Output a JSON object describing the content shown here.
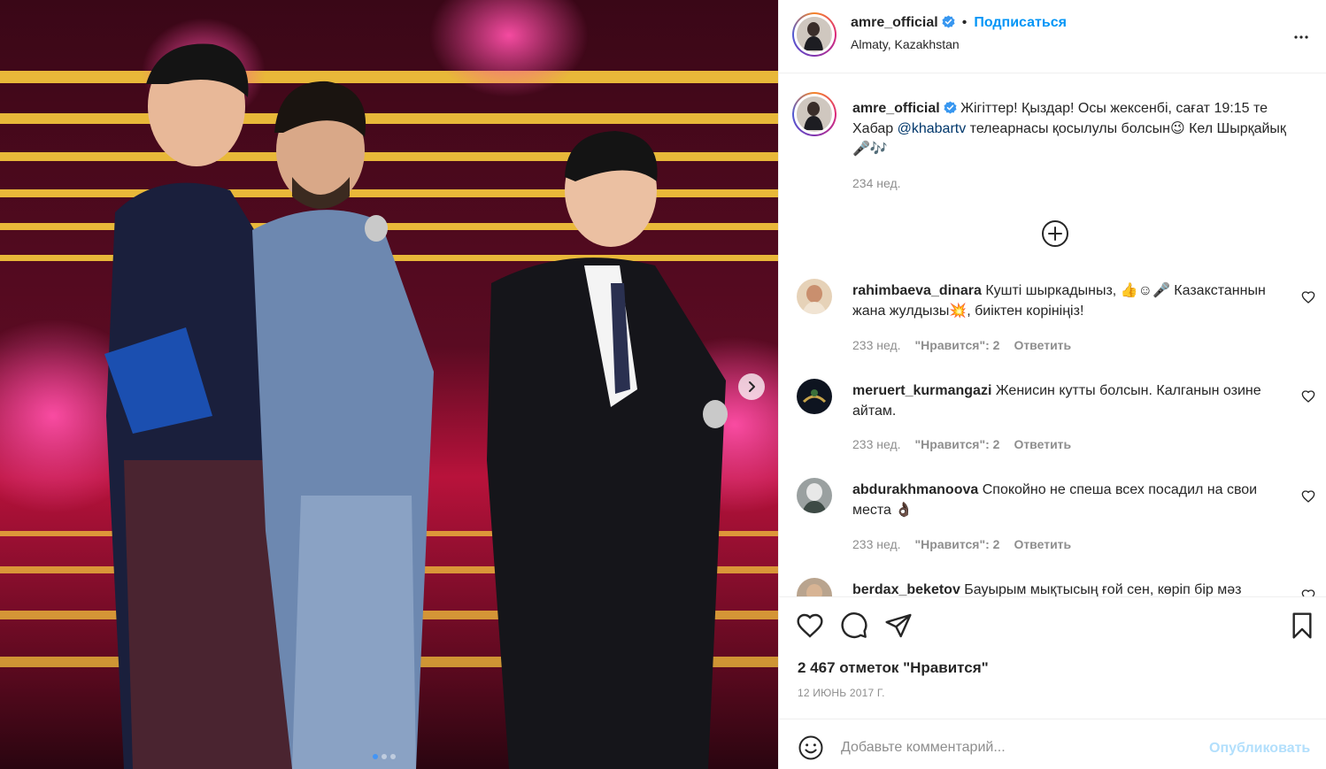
{
  "post": {
    "username": "amre_official",
    "verified": true,
    "follow_label": "Подписаться",
    "bullet": "•",
    "location": "Almaty, Kazakhstan",
    "caption": {
      "username": "amre_official",
      "text_before": "Жігіттер! Қыздар! Осы жексенбі, сағат 19:15 те Хабар ",
      "mention": "@khabartv",
      "text_after": " телеарнасы қосылулы болсын😉 Кел Шырқайық 🎤🎶",
      "time": "234 нед."
    },
    "comments": [
      {
        "username": "rahimbaeva_dinara",
        "text": "Кушті шыркадыныз, 👍☺🎤 Казакстаннын жана жулдызы💥, биіктен корініңіз!",
        "time": "233 нед.",
        "likes": "\"Нравится\": 2",
        "reply": "Ответить"
      },
      {
        "username": "meruert_kurmangazi",
        "text": "Женисин кутты болсын. Калганын озине айтам.",
        "time": "233 нед.",
        "likes": "\"Нравится\": 2",
        "reply": "Ответить"
      },
      {
        "username": "abdurakhmanoova",
        "text": "Спокойно не спеша всех посадил на свои места 👌🏿",
        "time": "233 нед.",
        "likes": "\"Нравится\": 2",
        "reply": "Ответить"
      },
      {
        "username": "berdax_beketov",
        "text": "Бауырым мықтысың ғой сен, көріп бір мәз",
        "time": "",
        "likes": "",
        "reply": ""
      }
    ],
    "likes_count": "2 467 отметок \"Нравится\"",
    "date": "12 ИЮНЬ 2017 Г.",
    "comment_placeholder": "Добавьте комментарий...",
    "publish_label": "Опубликовать",
    "carousel": {
      "count": 3,
      "active": 0
    },
    "icons": {
      "like": "heart-icon",
      "comment": "comment-icon",
      "share": "share-icon",
      "save": "bookmark-icon",
      "more": "more-dots-icon",
      "emoji": "emoji-icon",
      "load_more": "plus-circle-icon",
      "next": "chevron-right-icon"
    },
    "colors": {
      "link": "#0095f6",
      "mention": "#00376b",
      "muted": "#8e8e8e",
      "publish_disabled": "#b2dffc"
    }
  }
}
